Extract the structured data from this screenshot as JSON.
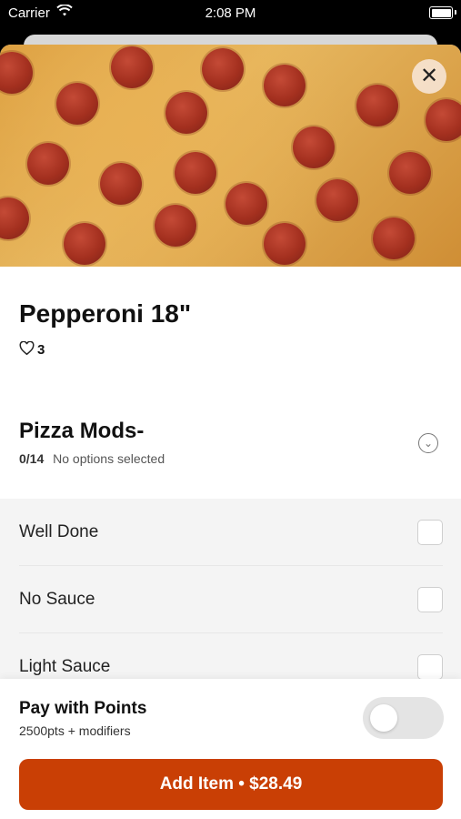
{
  "status_bar": {
    "carrier": "Carrier",
    "time": "2:08 PM"
  },
  "item": {
    "title": "Pepperoni 18\"",
    "likes": "3"
  },
  "modifiers": {
    "title": "Pizza Mods-",
    "count": "0/14",
    "status": "No options selected",
    "options": [
      {
        "label": "Well Done",
        "checked": false
      },
      {
        "label": "No Sauce",
        "checked": false
      },
      {
        "label": "Light Sauce",
        "checked": false
      }
    ]
  },
  "points": {
    "title": "Pay with Points",
    "subtitle": "2500pts + modifiers",
    "enabled": false
  },
  "cta": {
    "label": "Add Item • $28.49"
  },
  "colors": {
    "accent": "#c93f05",
    "toggle_off": "#e4e4e4"
  },
  "icons": {
    "close": "close-icon",
    "heart": "heart-icon",
    "chevron": "chevron-down-icon",
    "wifi": "wifi-icon"
  }
}
